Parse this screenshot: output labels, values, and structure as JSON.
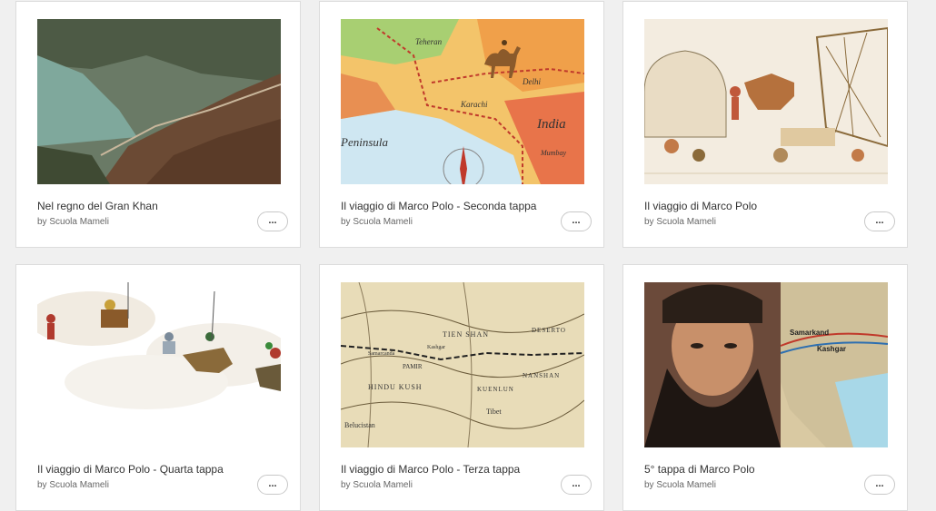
{
  "cards": [
    {
      "title": "Nel regno del Gran Khan",
      "author": "by Scuola Mameli",
      "menu": "..."
    },
    {
      "title": "Il viaggio di Marco Polo - Seconda tappa",
      "author": "by Scuola Mameli",
      "menu": "...",
      "map_labels": [
        "Teheran",
        "Delhi",
        "Karachi",
        "India",
        "Peninsula",
        "Mumbay"
      ]
    },
    {
      "title": "Il viaggio di Marco Polo",
      "author": "by Scuola Mameli",
      "menu": "..."
    },
    {
      "title": "Il viaggio di Marco Polo - Quarta tappa",
      "author": "by Scuola Mameli",
      "menu": "..."
    },
    {
      "title": "Il viaggio di Marco Polo - Terza tappa",
      "author": "by Scuola Mameli",
      "menu": "...",
      "map_labels": [
        "TIEN SHAN",
        "PAMIR",
        "HINDU KUSH",
        "KUENLUN",
        "Tibet",
        "Samarcanda",
        "Kashgar",
        "Belucistan",
        "NANSHAN",
        "DESERTO"
      ]
    },
    {
      "title": "5° tappa di Marco Polo",
      "author": "by Scuola Mameli",
      "menu": "...",
      "map_labels": [
        "Samarkand",
        "Kashgar"
      ]
    }
  ]
}
